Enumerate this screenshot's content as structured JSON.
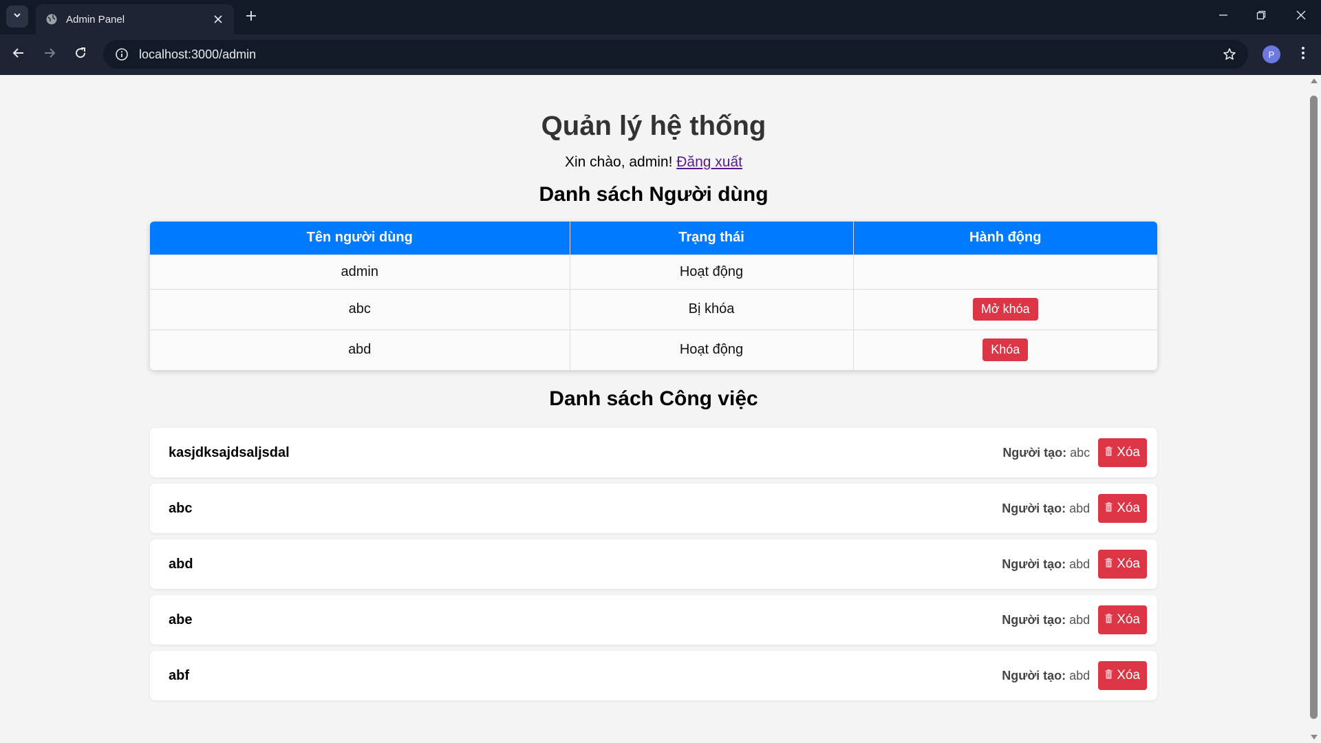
{
  "browser": {
    "tab_title": "Admin Panel",
    "url": "localhost:3000/admin",
    "profile_initial": "P",
    "accent_color": "#131a27"
  },
  "page": {
    "title": "Quản lý hệ thống",
    "greeting": "Xin chào, admin!",
    "logout_label": "Đăng xuất",
    "users_section_title": "Danh sách Người dùng",
    "tasks_section_title": "Danh sách Công việc"
  },
  "users_table": {
    "headers": [
      "Tên người dùng",
      "Trạng thái",
      "Hành động"
    ],
    "header_color": "#007bff",
    "rows": [
      {
        "username": "admin",
        "status": "Hoạt động",
        "action": ""
      },
      {
        "username": "abc",
        "status": "Bị khóa",
        "action": "Mở khóa"
      },
      {
        "username": "abd",
        "status": "Hoạt động",
        "action": "Khóa"
      }
    ]
  },
  "tasks": {
    "creator_label": "Người tạo:",
    "delete_label": "Xóa",
    "delete_color": "#dc3545",
    "items": [
      {
        "name": "kasjdksajdsaljsdal",
        "creator": "abc"
      },
      {
        "name": "abc",
        "creator": "abd"
      },
      {
        "name": "abd",
        "creator": "abd"
      },
      {
        "name": "abe",
        "creator": "abd"
      },
      {
        "name": "abf",
        "creator": "abd"
      }
    ]
  }
}
